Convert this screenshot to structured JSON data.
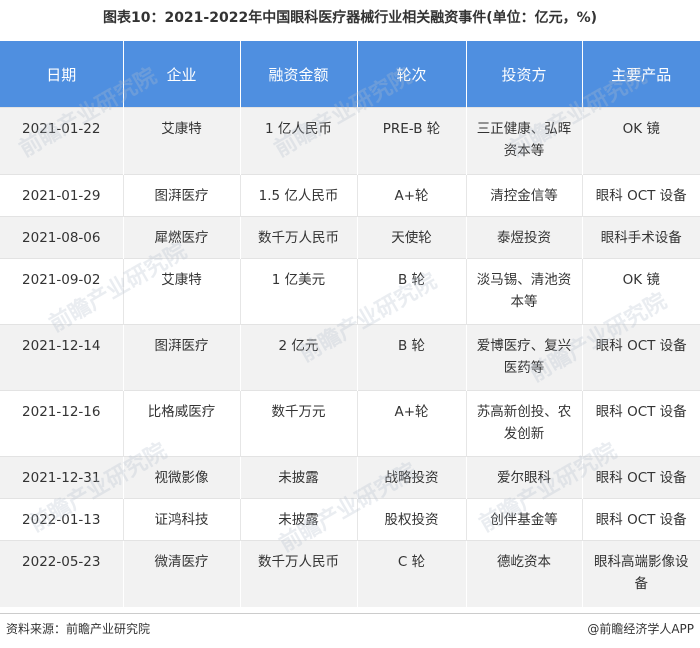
{
  "title": "图表10：2021-2022年中国眼科医疗器械行业相关融资事件(单位：亿元，%)",
  "table": {
    "headers": [
      "日期",
      "企业",
      "融资金额",
      "轮次",
      "投资方",
      "主要产品"
    ],
    "rows": [
      [
        "2021-01-22",
        "艾康特",
        "1 亿人民币",
        "PRE-B 轮",
        "三正健康、弘晖资本等",
        "OK 镜"
      ],
      [
        "2021-01-29",
        "图湃医疗",
        "1.5 亿人民币",
        "A+轮",
        "清控金信等",
        "眼科 OCT 设备"
      ],
      [
        "2021-08-06",
        "犀燃医疗",
        "数千万人民币",
        "天使轮",
        "泰煜投资",
        "眼科手术设备"
      ],
      [
        "2021-09-02",
        "艾康特",
        "1 亿美元",
        "B 轮",
        "淡马锡、清池资本等",
        "OK 镜"
      ],
      [
        "2021-12-14",
        "图湃医疗",
        "2 亿元",
        "B 轮",
        "爱博医疗、复兴医药等",
        "眼科 OCT 设备"
      ],
      [
        "2021-12-16",
        "比格威医疗",
        "数千万元",
        "A+轮",
        "苏高新创投、农发创新",
        "眼科 OCT 设备"
      ],
      [
        "2021-12-31",
        "视微影像",
        "未披露",
        "战略投资",
        "爱尔眼科",
        "眼科 OCT 设备"
      ],
      [
        "2022-01-13",
        "证鸿科技",
        "未披露",
        "股权投资",
        "创伴基金等",
        "眼科 OCT 设备"
      ],
      [
        "2022-05-23",
        "微清医疗",
        "数千万人民币",
        "C 轮",
        "德屹资本",
        "眼科高端影像设备"
      ]
    ]
  },
  "watermark": "前瞻产业研究院",
  "footer": {
    "source": "资料来源：前瞻产业研究院",
    "credit": "@前瞻经济学人APP"
  }
}
